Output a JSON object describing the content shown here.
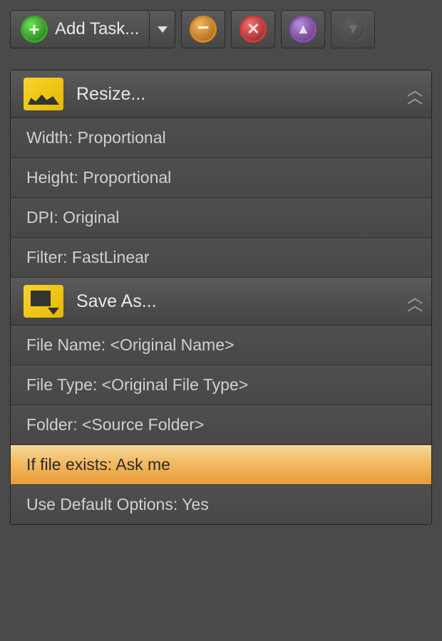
{
  "toolbar": {
    "add_task_label": "Add Task..."
  },
  "sections": {
    "resize": {
      "title": "Resize...",
      "rows": {
        "width": "Width: Proportional",
        "height": "Height: Proportional",
        "dpi": "DPI: Original",
        "filter": "Filter: FastLinear"
      }
    },
    "save_as": {
      "title": "Save As...",
      "rows": {
        "file_name": "File Name: <Original Name>",
        "file_type": "File Type: <Original File Type>",
        "folder": "Folder: <Source Folder>",
        "if_exists": "If file exists: Ask me",
        "use_defaults": "Use Default Options: Yes"
      }
    }
  }
}
